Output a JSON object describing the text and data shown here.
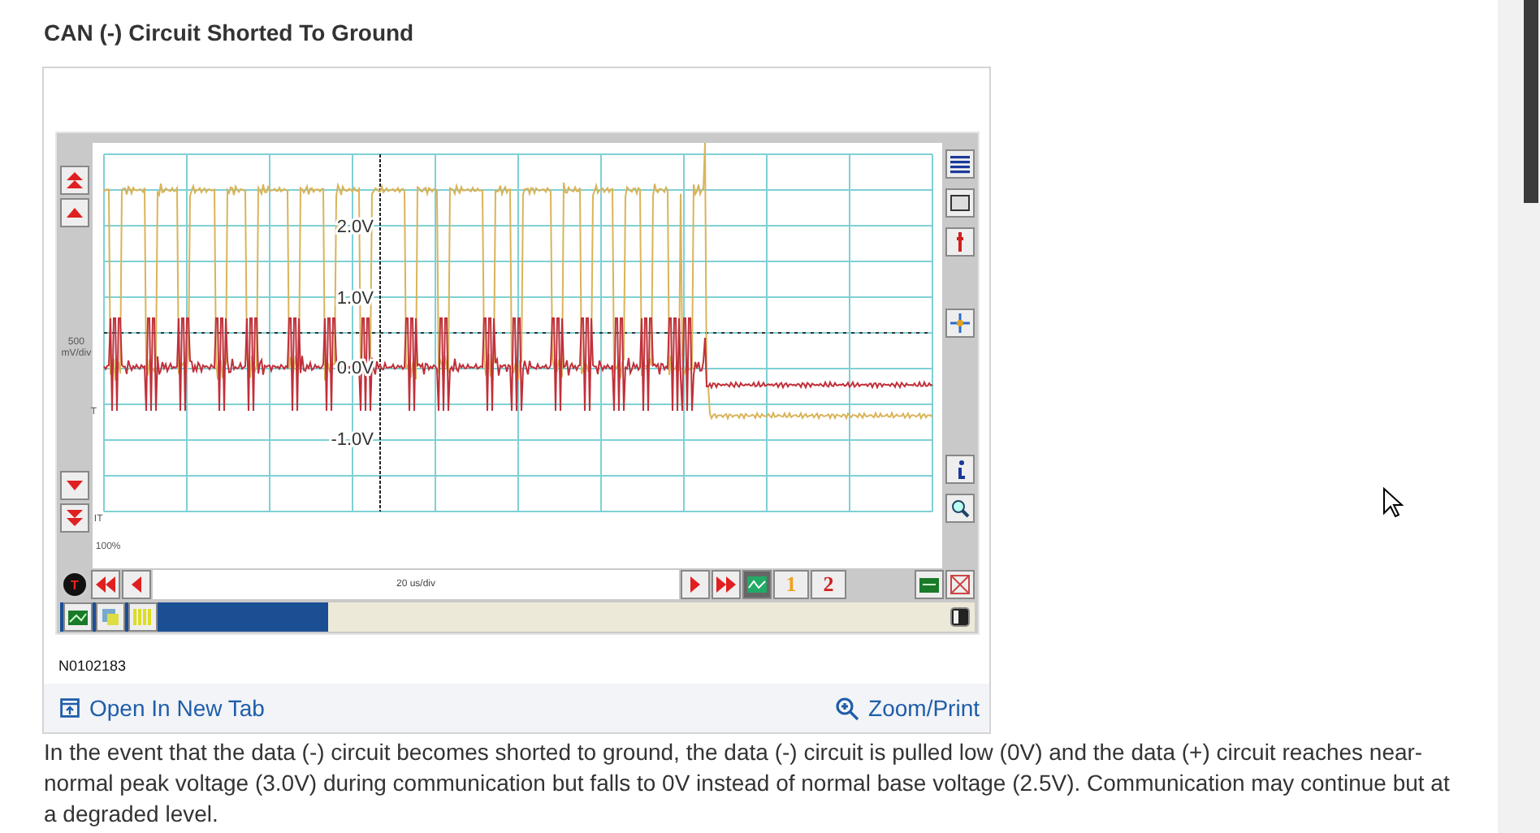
{
  "title": "CAN (-) Circuit Shorted To Ground",
  "figure": {
    "scope": {
      "volt_labels": [
        "2.0V",
        "1.0V",
        "0.0V",
        "-1.0V"
      ],
      "scale": "500 mV/div",
      "trigger_marker": "T",
      "bottom_marker": "IT",
      "zoom": "100%",
      "trigger_button": "T",
      "timebase": "20 us/div",
      "channel_buttons": [
        {
          "label": "1",
          "color": "#f0a020"
        },
        {
          "label": "2",
          "color": "#d02020"
        }
      ]
    },
    "figure_id": "N0102183",
    "links": [
      {
        "label": "Open In New Tab",
        "kind": "open"
      },
      {
        "label": "Zoom/Print",
        "kind": "zoom"
      }
    ]
  },
  "description": "In the event that the data (-) circuit becomes shorted to ground, the data (-) circuit is pulled low (0V) and the data (+) circuit reaches near-normal peak voltage (3.0V) during communication but falls to 0V instead of normal base voltage (2.5V). Communication may continue but at a degraded level."
}
